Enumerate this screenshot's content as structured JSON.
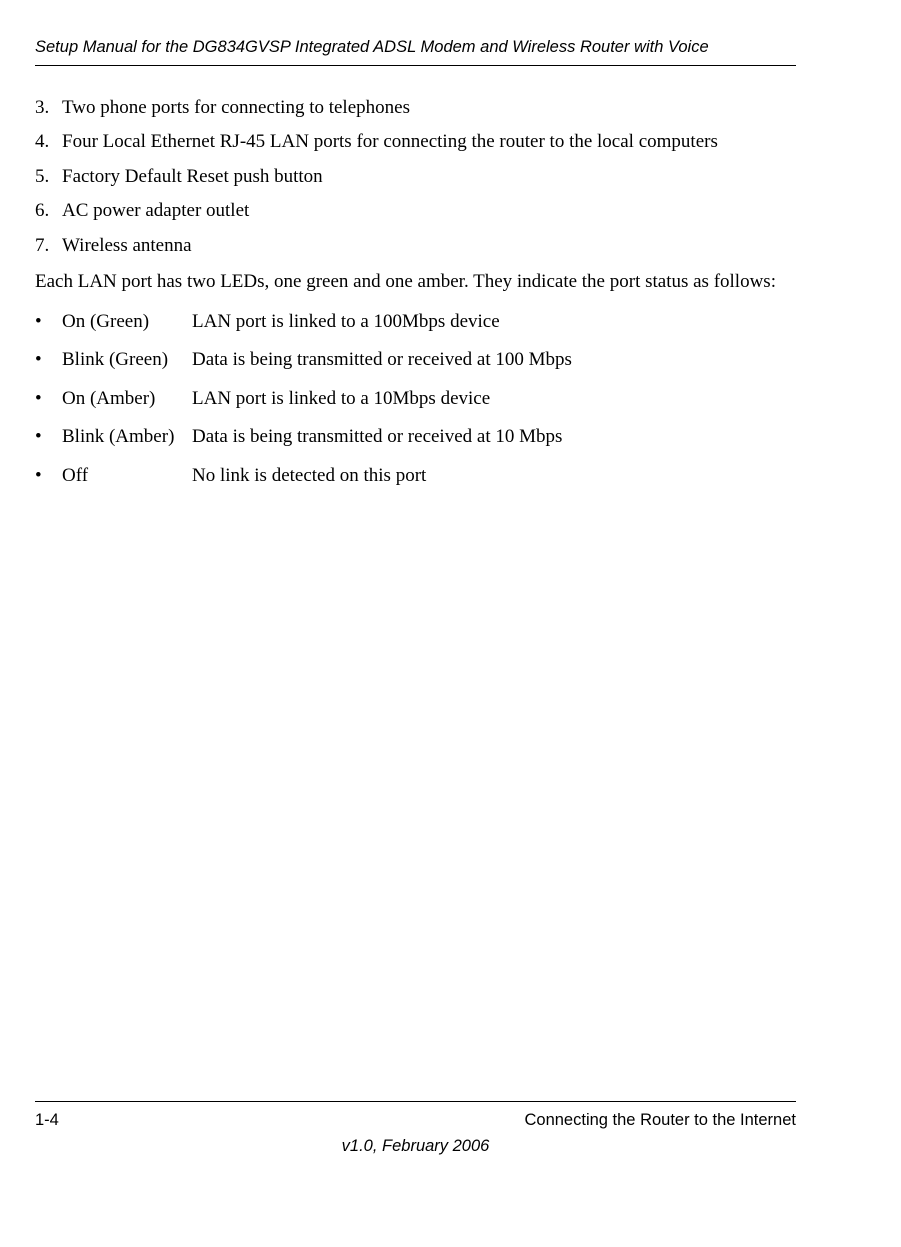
{
  "header": {
    "title": "Setup Manual for the DG834GVSP Integrated ADSL Modem and Wireless Router with Voice"
  },
  "list": {
    "items": [
      {
        "num": "3.",
        "text": "Two phone ports for connecting to telephones"
      },
      {
        "num": "4.",
        "text": "Four Local Ethernet RJ-45 LAN ports for connecting the router to the local computers"
      },
      {
        "num": "5.",
        "text": "Factory Default Reset push button"
      },
      {
        "num": "6.",
        "text": "AC power adapter outlet"
      },
      {
        "num": "7.",
        "text": "Wireless antenna"
      }
    ]
  },
  "paragraph": "Each LAN port has two LEDs, one green and one amber. They indicate the port status as follows:",
  "bullets": {
    "items": [
      {
        "dot": "•",
        "state": "On (Green)",
        "desc": "LAN port is linked to a 100Mbps device"
      },
      {
        "dot": "•",
        "state": "Blink (Green)",
        "desc": "Data is being transmitted or received at 100 Mbps"
      },
      {
        "dot": "•",
        "state": "On (Amber)",
        "desc": "LAN port is linked to a 10Mbps device"
      },
      {
        "dot": "•",
        "state": "Blink (Amber)",
        "desc": "Data is being transmitted or received at 10 Mbps"
      },
      {
        "dot": "•",
        "state": "Off",
        "desc": "No link is detected on this port"
      }
    ]
  },
  "footer": {
    "page_left": "1-4",
    "page_right": "Connecting the Router to the Internet",
    "version": "v1.0, February 2006"
  }
}
